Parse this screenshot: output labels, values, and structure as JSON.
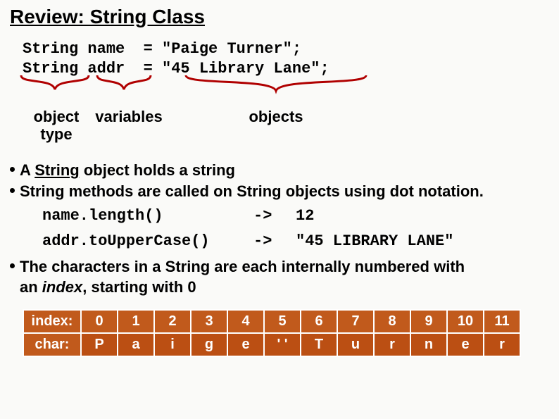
{
  "title": "Review: String Class",
  "code": {
    "line1": "String name  = \"Paige Turner\";",
    "line2": "String addr  = \"45 Library Lane\";"
  },
  "braces": {
    "object_type": "object\ntype",
    "variables": "variables",
    "objects": "objects"
  },
  "bullets": {
    "b1_pre": "A ",
    "b1_string": "String",
    "b1_post": " object holds a string",
    "b2": " String methods are called on String objects using dot notation.",
    "b3_a": " The characters in a String are each internally numbered with",
    "b3_b": " an ",
    "b3_index": "index",
    "b3_c": ", starting with 0"
  },
  "examples": {
    "call1": "name.length()",
    "arrow": "->",
    "res1": "12",
    "call2": "addr.toUpperCase()",
    "res2": "\"45 LIBRARY LANE\""
  },
  "chart_data": {
    "type": "table",
    "title": "String character indices",
    "row_labels": [
      "index:",
      "char:"
    ],
    "index": [
      "0",
      "1",
      "2",
      "3",
      "4",
      "5",
      "6",
      "7",
      "8",
      "9",
      "10",
      "11"
    ],
    "chars": [
      "P",
      "a",
      "i",
      "g",
      "e",
      "' '",
      "T",
      "u",
      "r",
      "n",
      "e",
      "r"
    ]
  }
}
